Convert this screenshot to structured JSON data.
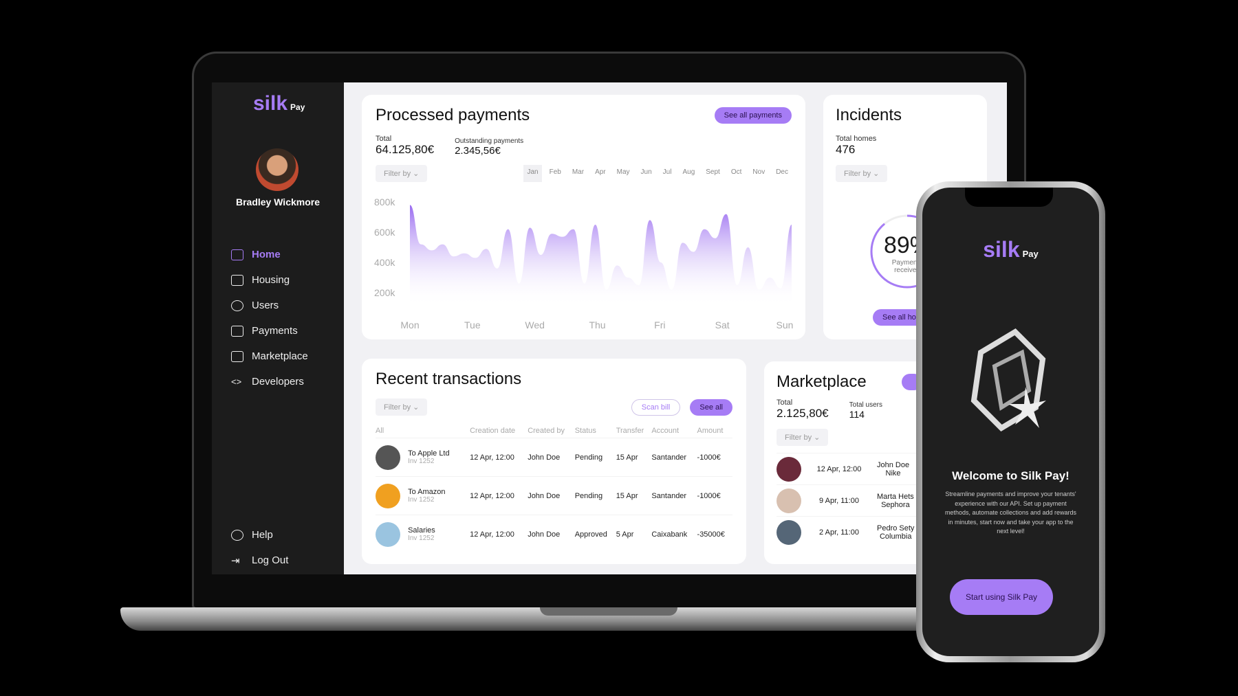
{
  "brand": {
    "name": "silk",
    "suffix": "Pay",
    "accent": "#a67cf5"
  },
  "user": {
    "name": "Bradley Wickmore"
  },
  "sidebar": {
    "items": [
      {
        "label": "Home",
        "icon": "home-icon",
        "active": true
      },
      {
        "label": "Housing",
        "icon": "house-icon"
      },
      {
        "label": "Users",
        "icon": "user-icon"
      },
      {
        "label": "Payments",
        "icon": "credit-card-icon"
      },
      {
        "label": "Marketplace",
        "icon": "shopping-bag-icon"
      },
      {
        "label": "Developers",
        "icon": "code-icon"
      }
    ],
    "bottom": [
      {
        "label": "Help",
        "icon": "help-icon"
      },
      {
        "label": "Log Out",
        "icon": "logout-icon"
      }
    ]
  },
  "payments": {
    "title": "Processed payments",
    "see_all": "See all payments",
    "total_label": "Total",
    "total": "64.125,80€",
    "outstanding_label": "Outstanding payments",
    "outstanding": "2.345,56€",
    "filter": "Filter by",
    "months": [
      "Jan",
      "Feb",
      "Mar",
      "Apr",
      "May",
      "Jun",
      "Jul",
      "Aug",
      "Sept",
      "Oct",
      "Nov",
      "Dec"
    ],
    "selected_month": "Jan"
  },
  "chart_data": {
    "type": "area",
    "x": [
      "Mon",
      "Tue",
      "Wed",
      "Thu",
      "Fri",
      "Sat",
      "Sun"
    ],
    "yticks": [
      "800k",
      "600k",
      "400k",
      "200k"
    ],
    "ylim": [
      200,
      800
    ],
    "values": [
      780,
      520,
      480,
      520,
      440,
      460,
      430,
      490,
      360,
      620,
      260,
      630,
      450,
      590,
      570,
      620,
      260,
      650,
      220,
      380,
      300,
      250,
      680,
      400,
      220,
      530,
      470,
      620,
      560,
      720,
      250,
      500,
      220,
      300,
      230,
      650
    ]
  },
  "incidents": {
    "title": "Incidents",
    "total_label": "Total homes",
    "total": "476",
    "filter": "Filter by",
    "percent": 89,
    "percent_text": "89%",
    "percent_label": "Payments received",
    "see_all": "See all homes"
  },
  "transactions": {
    "title": "Recent transactions",
    "filter": "Filter by",
    "scan": "Scan bill",
    "see_all": "See all",
    "columns": [
      "All",
      "Creation date",
      "Created by",
      "Status",
      "Transfer",
      "Account",
      "Amount"
    ],
    "rows": [
      {
        "name": "To Apple Ltd",
        "inv": "Inv 1252",
        "date": "12 Apr, 12:00",
        "by": "John Doe",
        "status": "Pending",
        "transfer": "15 Apr",
        "account": "Santander",
        "amount": "-1000€"
      },
      {
        "name": "To Amazon",
        "inv": "Inv 1252",
        "date": "12 Apr, 12:00",
        "by": "John Doe",
        "status": "Pending",
        "transfer": "15 Apr",
        "account": "Santander",
        "amount": "-1000€"
      },
      {
        "name": "Salaries",
        "inv": "Inv 1252",
        "date": "12 Apr, 12:00",
        "by": "John Doe",
        "status": "Approved",
        "transfer": "5 Apr",
        "account": "Caixabank",
        "amount": "-35000€"
      }
    ]
  },
  "marketplace": {
    "title": "Marketplace",
    "total_label": "Total",
    "total": "2.125,80€",
    "users_label": "Total users",
    "users": "114",
    "filter": "Filter by",
    "rows": [
      {
        "date": "12 Apr, 12:00",
        "name": "John Doe",
        "brand": "Nike"
      },
      {
        "date": "9 Apr, 11:00",
        "name": "Marta Hets",
        "brand": "Sephora"
      },
      {
        "date": "2 Apr, 11:00",
        "name": "Pedro Sety",
        "brand": "Columbia"
      }
    ]
  },
  "phone": {
    "welcome": "Welcome to Silk Pay!",
    "body": "Streamline payments and improve your tenants' experience with our API. Set up payment methods, automate collections and add rewards in minutes, start now and take your app to the next level!",
    "cta": "Start using Silk Pay"
  }
}
